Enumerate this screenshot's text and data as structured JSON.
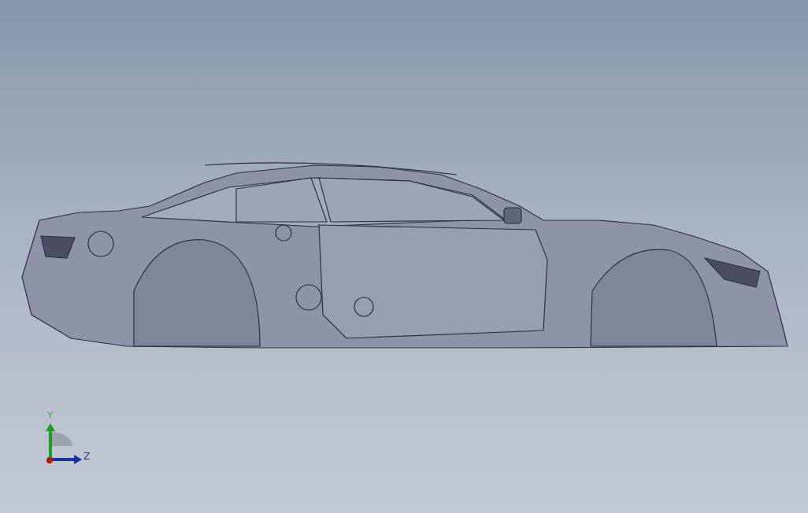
{
  "viewport": {
    "model": {
      "kind": "car"
    }
  },
  "triad": {
    "y_label": "Y",
    "z_label": "Z"
  }
}
